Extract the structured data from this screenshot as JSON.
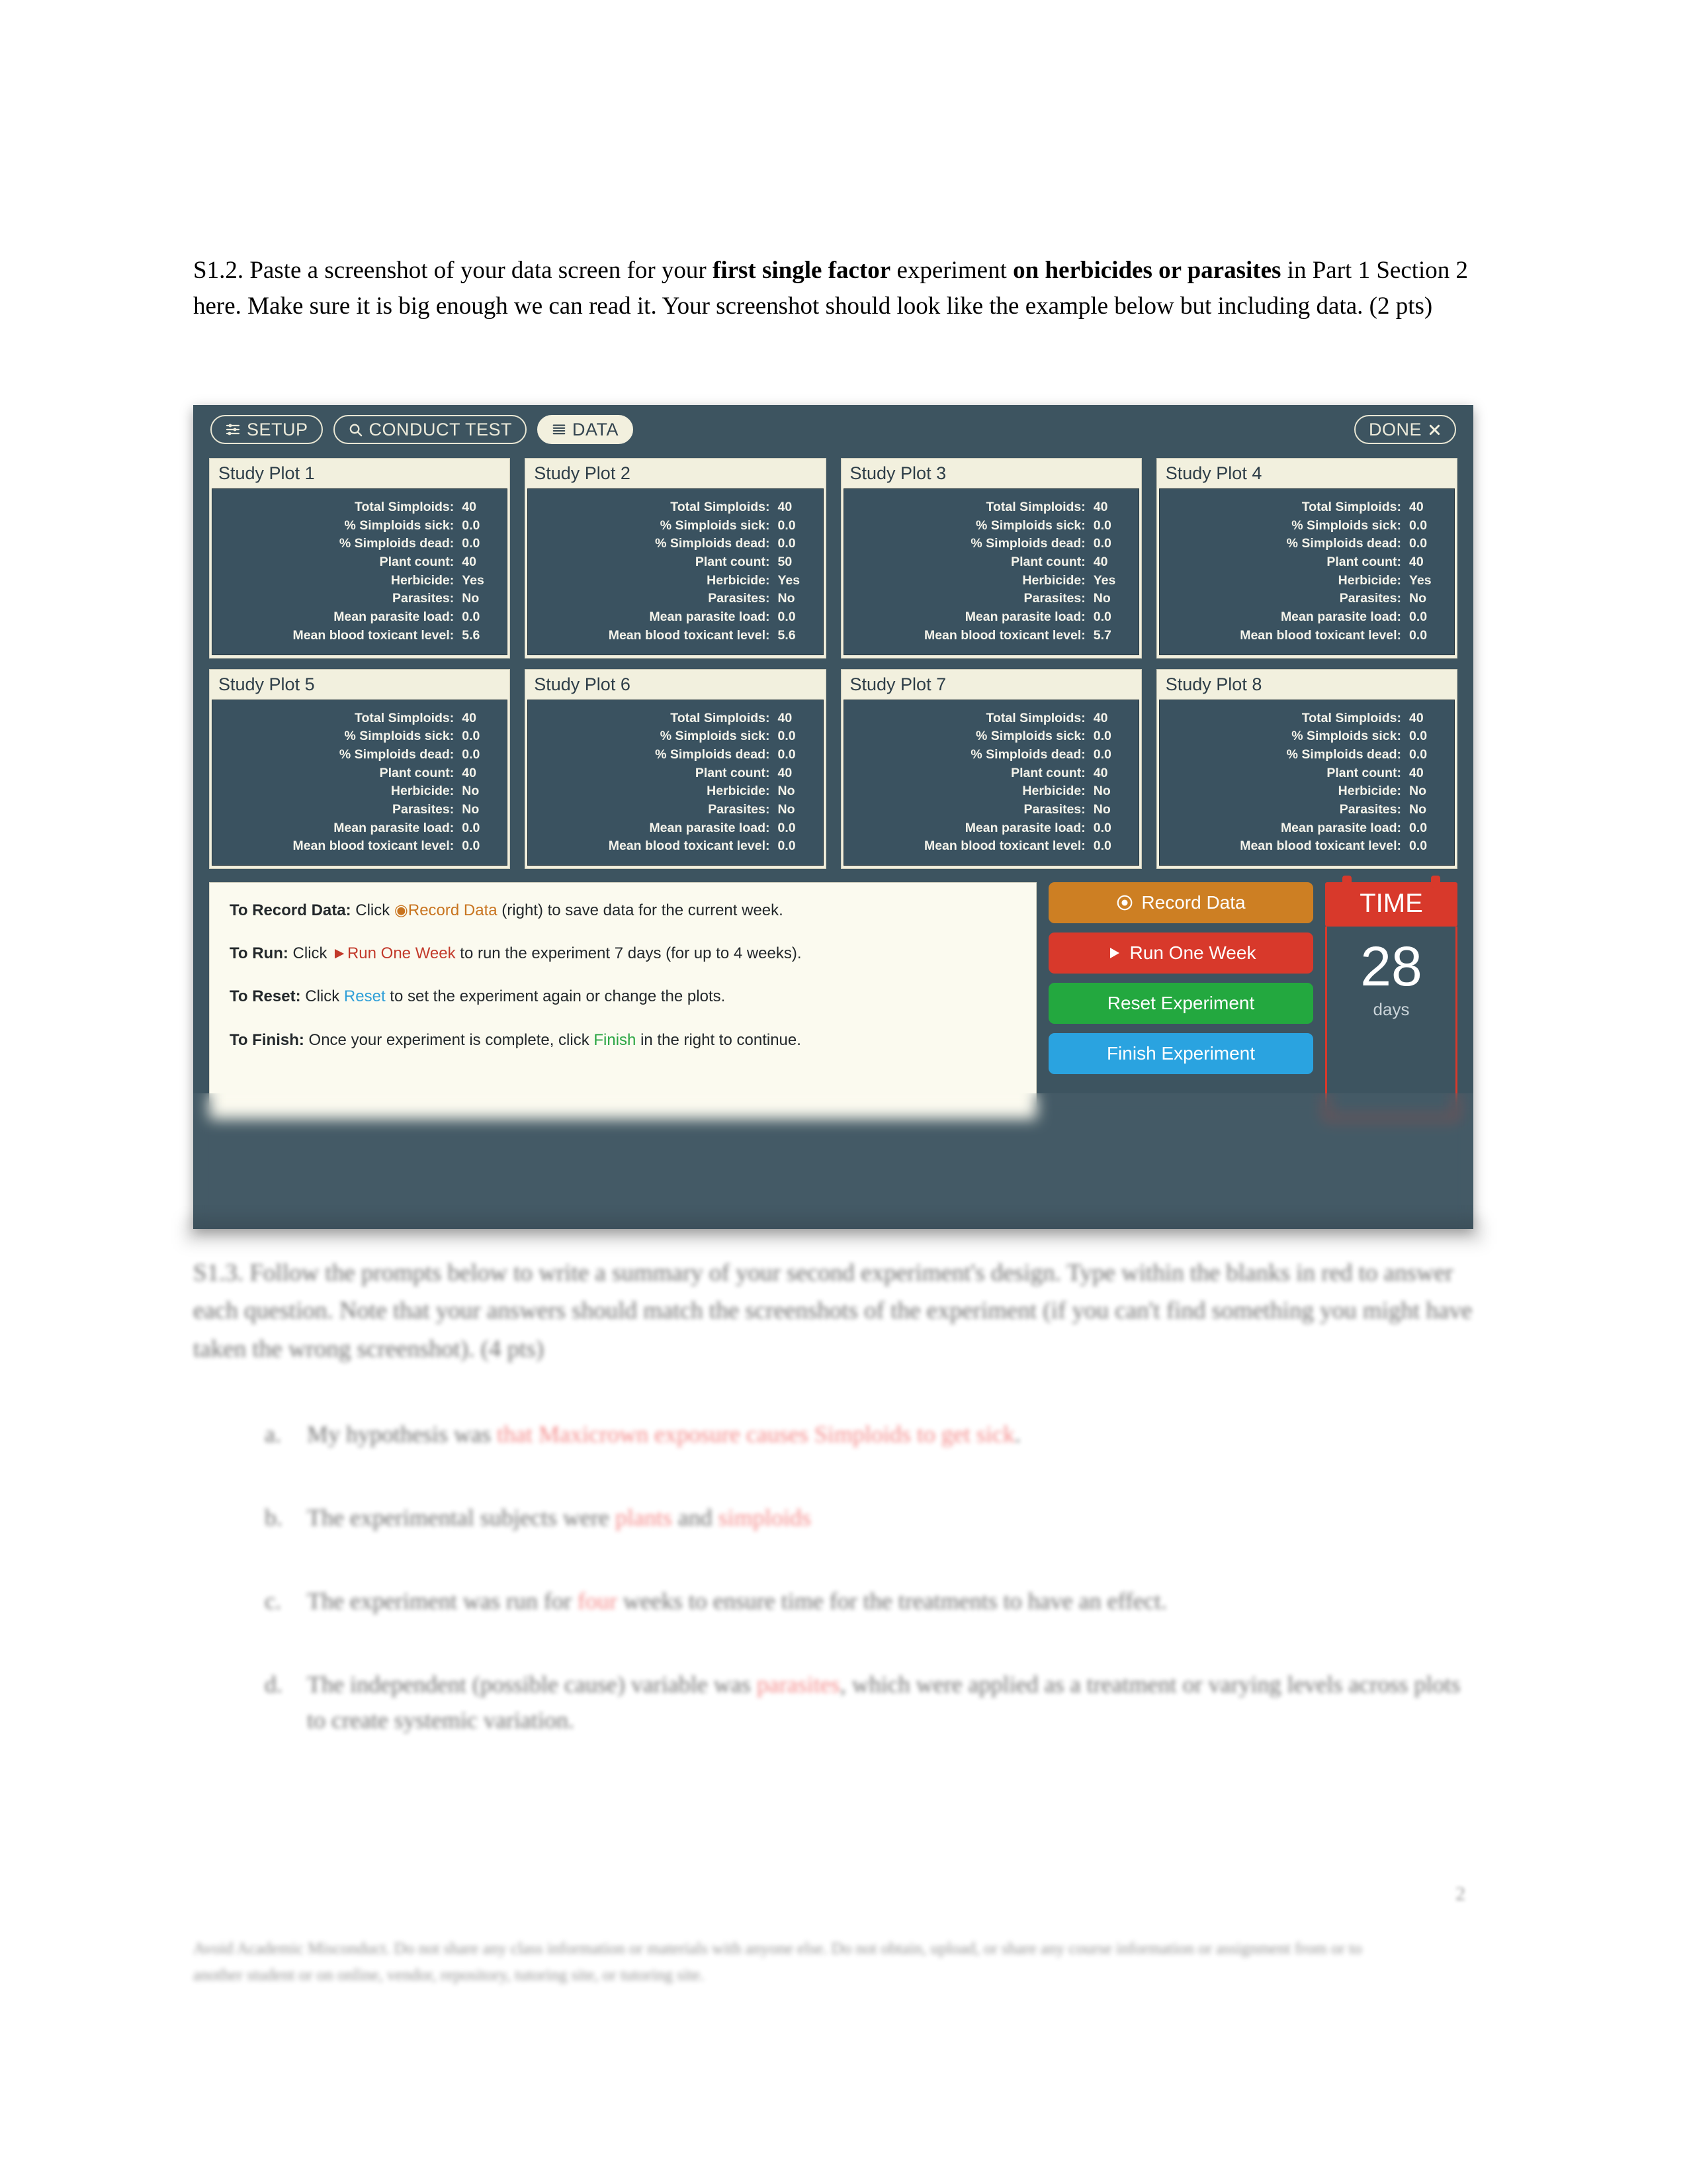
{
  "document": {
    "prompt_parts": [
      {
        "text": "S1.2. Paste a screenshot of your data screen for your ",
        "bold": false
      },
      {
        "text": "first single factor",
        "bold": true
      },
      {
        "text": " experiment ",
        "bold": false
      },
      {
        "text": "on herbicides or parasites",
        "bold": true
      },
      {
        "text": " in Part 1 Section 2 here. Make sure it is big enough we can read it. Your screenshot should look like the example below but including data. (2 pts)",
        "bold": false
      }
    ],
    "page_number": "2",
    "blurred_paragraph": "S1.3. Follow the prompts below to write a summary of your second experiment's design. Type within the blanks in red to answer each question. Note that your answers should match the screenshots of the experiment (if you can't find something you might have taken the wrong screenshot). (4 pts)",
    "blurred_items": [
      {
        "marker": "a.",
        "text": "My hypothesis was ",
        "answer": "that Maxicrown exposure causes Simploids to get sick",
        "tail": "."
      },
      {
        "marker": "b.",
        "text": "The experimental subjects were ",
        "answer": "plants",
        "mid": " and ",
        "answer2": "simploids",
        "tail": ""
      },
      {
        "marker": "c.",
        "text": "The experiment was run for ",
        "answer": "four",
        "tail": " weeks to ensure time for the treatments to have an effect."
      },
      {
        "marker": "d.",
        "text": "The independent (possible cause) variable was ",
        "answer": "parasites",
        "tail": ", which were applied as a treatment or varying levels across plots to create systemic variation."
      }
    ],
    "blurred_footer": "Avoid Academic Misconduct. Do not share any class information or materials with anyone else. Do not obtain, upload, or share any course information or assignment from or to another student or on online, vendor, repository, tutoring site, or tutoring site."
  },
  "simulator": {
    "toolbar": {
      "setup": "SETUP",
      "conduct_test": "CONDUCT TEST",
      "data": "DATA",
      "done": "DONE",
      "active_tab": "DATA"
    },
    "stat_labels": [
      "Total Simploids:",
      "% Simploids sick:",
      "% Simploids dead:",
      "Plant count:",
      "Herbicide:",
      "Parasites:",
      "Mean parasite load:",
      "Mean blood toxicant level:"
    ],
    "plots": [
      {
        "title": "Study Plot 1",
        "values": [
          "40",
          "0.0",
          "0.0",
          "40",
          "Yes",
          "No",
          "0.0",
          "5.6"
        ]
      },
      {
        "title": "Study Plot 2",
        "values": [
          "40",
          "0.0",
          "0.0",
          "50",
          "Yes",
          "No",
          "0.0",
          "5.6"
        ]
      },
      {
        "title": "Study Plot 3",
        "values": [
          "40",
          "0.0",
          "0.0",
          "40",
          "Yes",
          "No",
          "0.0",
          "5.7"
        ]
      },
      {
        "title": "Study Plot 4",
        "values": [
          "40",
          "0.0",
          "0.0",
          "40",
          "Yes",
          "No",
          "0.0",
          "0.0"
        ]
      },
      {
        "title": "Study Plot 5",
        "values": [
          "40",
          "0.0",
          "0.0",
          "40",
          "No",
          "No",
          "0.0",
          "0.0"
        ]
      },
      {
        "title": "Study Plot 6",
        "values": [
          "40",
          "0.0",
          "0.0",
          "40",
          "No",
          "No",
          "0.0",
          "0.0"
        ]
      },
      {
        "title": "Study Plot 7",
        "values": [
          "40",
          "0.0",
          "0.0",
          "40",
          "No",
          "No",
          "0.0",
          "0.0"
        ]
      },
      {
        "title": "Study Plot 8",
        "values": [
          "40",
          "0.0",
          "0.0",
          "40",
          "No",
          "No",
          "0.0",
          "0.0"
        ]
      }
    ],
    "instructions": {
      "record_label": "To Record Data:",
      "record_pre": " Click ",
      "record_accent": "Record Data",
      "record_post": " (right) to save data for the current week.",
      "run_label": "To Run:",
      "run_pre": " Click ",
      "run_accent": "Run One Week",
      "run_post": " to run the experiment 7 days (for up to 4 weeks).",
      "reset_label": "To Reset:",
      "reset_pre": " Click ",
      "reset_accent": "Reset",
      "reset_post": " to set the experiment again or change the plots.",
      "finish_label": "To Finish:",
      "finish_pre": " Once your experiment is complete, click ",
      "finish_accent": "Finish",
      "finish_post": " in the right to continue."
    },
    "buttons": {
      "record_data": "Record Data",
      "run_one_week": "Run One Week",
      "green_button": "Reset Experiment",
      "blue_button": "Finish Experiment"
    },
    "time": {
      "header": "TIME",
      "value": "28",
      "unit": "days"
    },
    "colors": {
      "window_bg": "#3d5460",
      "card_header": "#f2f0de",
      "card_body": "#3a5260",
      "orange": "#cd7f23",
      "red": "#d8392b",
      "green": "#23a83f",
      "blue": "#2aa3e0"
    }
  }
}
